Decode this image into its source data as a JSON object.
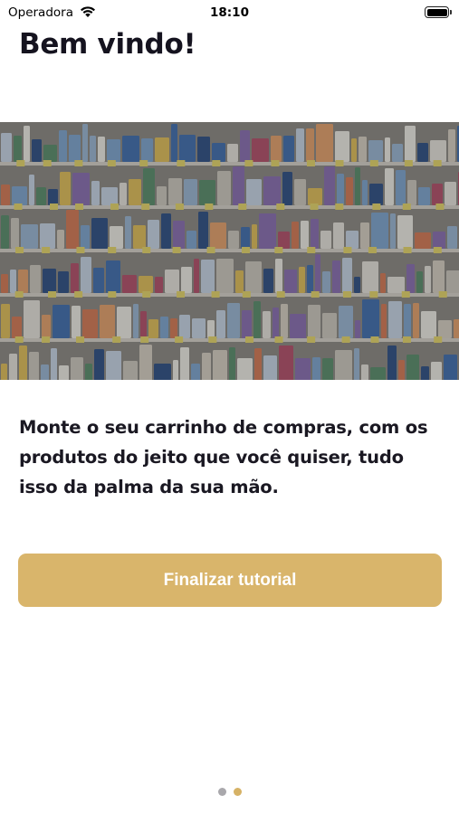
{
  "status_bar": {
    "carrier": "Operadora",
    "time": "18:10"
  },
  "screen": {
    "title": "Bem vindo!",
    "image_icon": "supermarket-shelves-photo",
    "description": "Monte o seu carrinho de compras, com os produtos do jeito que você quiser, tudo isso da palma da sua mão.",
    "button_label": "Finalizar tutorial"
  },
  "pager": {
    "current_page": 2,
    "total_pages": 2
  },
  "colors": {
    "accent": "#d9b56b",
    "text": "#15131f",
    "dot_inactive": "#a9a8ac"
  }
}
